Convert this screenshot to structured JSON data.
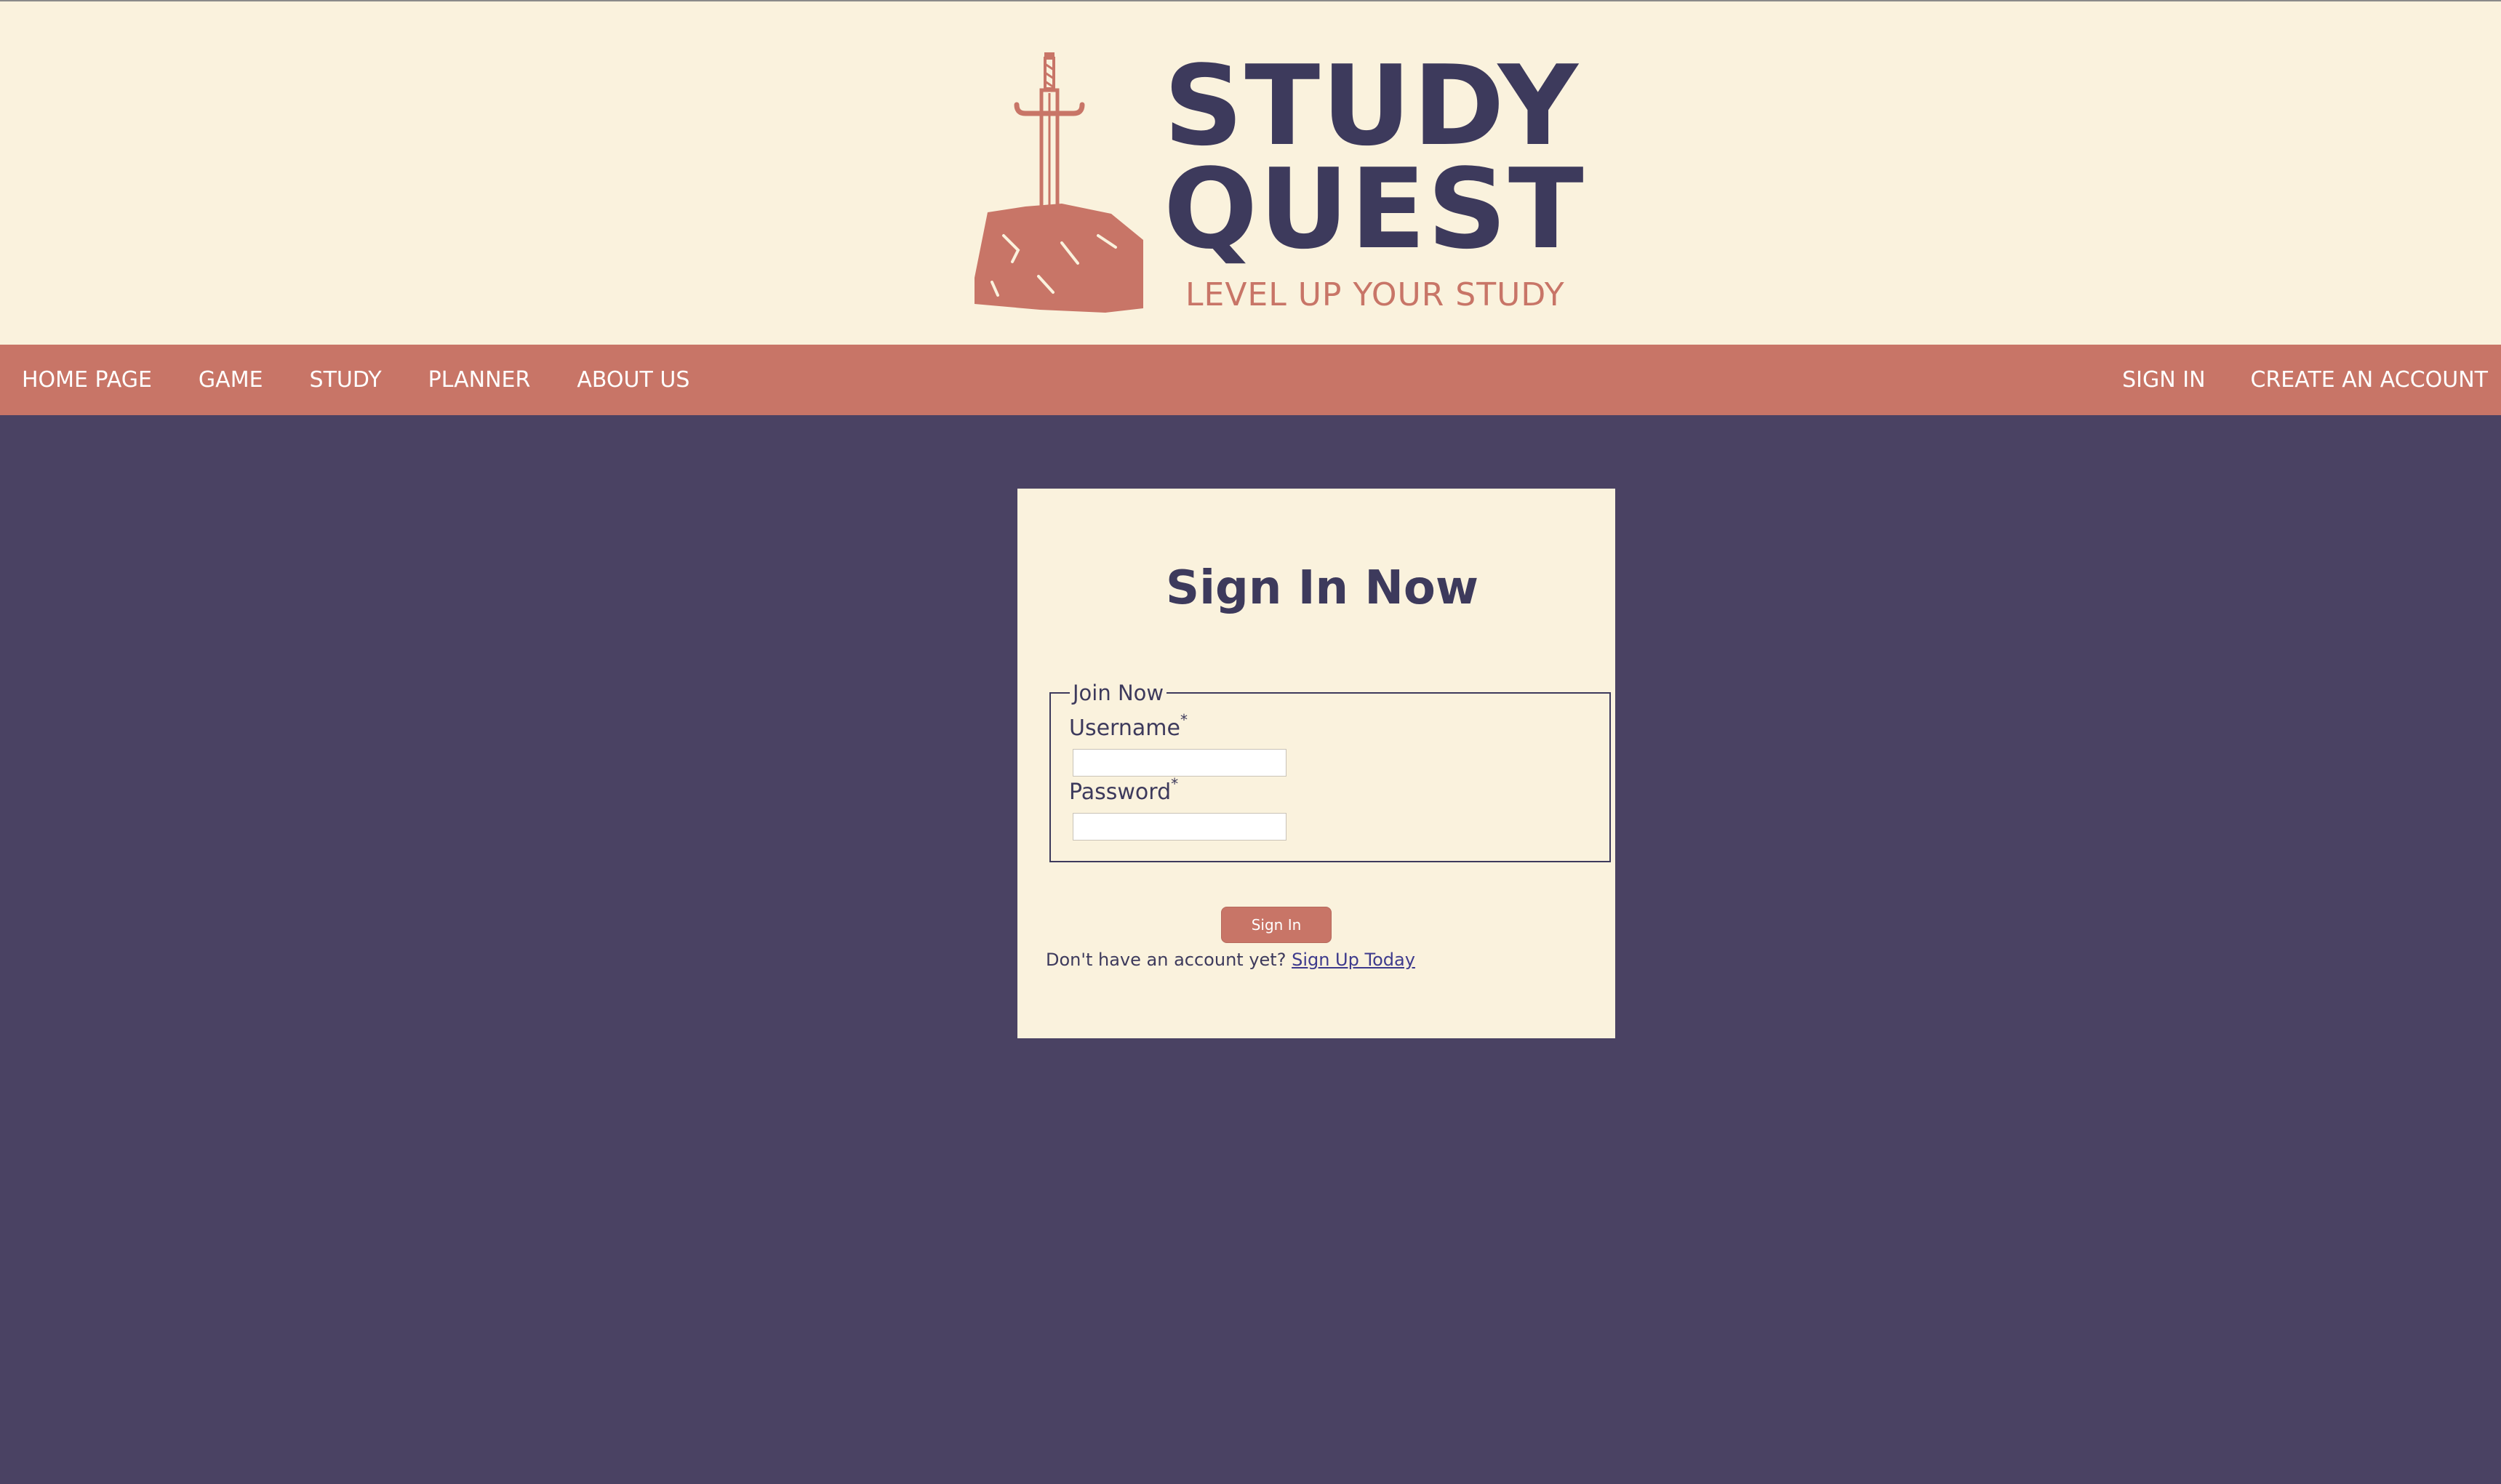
{
  "brand": {
    "line1": "STUDY",
    "line2": "QUEST",
    "tagline": "LEVEL UP YOUR STUDY",
    "colors": {
      "cream": "#faf2dd",
      "terracotta": "#c87567",
      "navy": "#3d3a5c",
      "background": "#4a4263"
    },
    "icon": "sword-in-stone-icon"
  },
  "nav": {
    "left": [
      {
        "label": "HOME PAGE"
      },
      {
        "label": "GAME"
      },
      {
        "label": "STUDY"
      },
      {
        "label": "PLANNER"
      },
      {
        "label": "ABOUT US"
      }
    ],
    "right": [
      {
        "label": "SIGN IN"
      },
      {
        "label": "CREATE AN ACCOUNT"
      }
    ]
  },
  "signin": {
    "title": "Sign In Now",
    "legend": "Join Now",
    "username_label": "Username",
    "password_label": "Password",
    "required_mark": "*",
    "username_value": "",
    "password_value": "",
    "button_label": "Sign In",
    "prompt_text": "Don't have an account yet?",
    "signup_link": "Sign Up Today"
  }
}
